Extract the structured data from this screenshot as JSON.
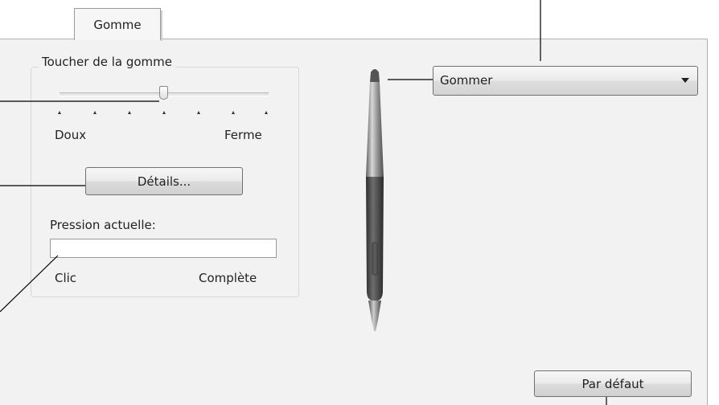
{
  "tab": {
    "label": "Gomme"
  },
  "eraser_feel": {
    "group_label": "Toucher de la gomme",
    "soft_label": "Doux",
    "firm_label": "Ferme",
    "details_button": "Détails...",
    "slider_level_fraction": 0.5,
    "tick_count": 7
  },
  "current_pressure": {
    "label": "Pression actuelle:",
    "min_label": "Clic",
    "max_label": "Complète",
    "level_fraction": 0
  },
  "eraser_function": {
    "selected": "Gommer"
  },
  "default_button": "Par défaut",
  "colors": {
    "panel_bg": "#f2f2f2",
    "pen_body": "#8a8a8a",
    "pen_grip": "#4a4a4a",
    "callout_line": "#000000"
  },
  "icons": {
    "pen": "pen-illustration-icon",
    "dropdown": "chevron-down-icon"
  }
}
